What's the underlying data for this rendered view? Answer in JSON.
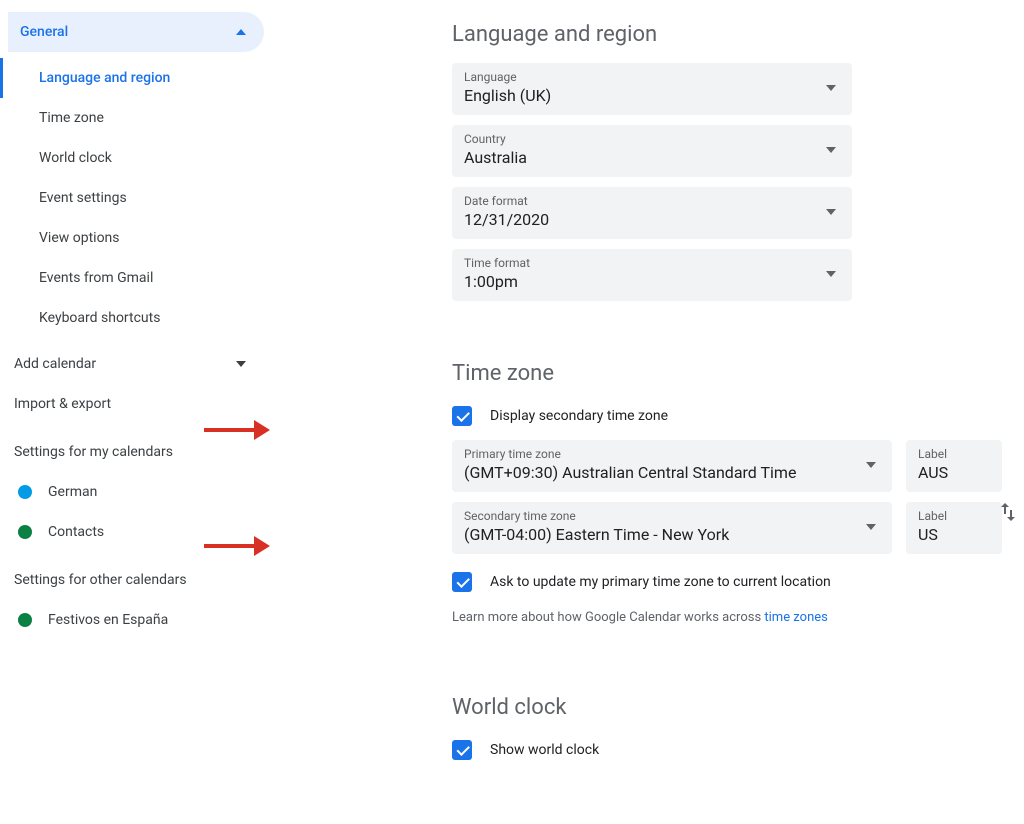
{
  "sidebar": {
    "general": {
      "label": "General",
      "items": [
        "Language and region",
        "Time zone",
        "World clock",
        "Event settings",
        "View options",
        "Events from Gmail",
        "Keyboard shortcuts"
      ]
    },
    "add_calendar": "Add calendar",
    "import_export": "Import & export",
    "my_calendars_label": "Settings for my calendars",
    "my_calendars": [
      {
        "name": "German",
        "color": "#039be5"
      },
      {
        "name": "Contacts",
        "color": "#0b8043"
      }
    ],
    "other_calendars_label": "Settings for other calendars",
    "other_calendars": [
      {
        "name": "Festivos en España",
        "color": "#0b8043"
      }
    ]
  },
  "lang_region": {
    "title": "Language and region",
    "language": {
      "label": "Language",
      "value": "English (UK)"
    },
    "country": {
      "label": "Country",
      "value": "Australia"
    },
    "date_format": {
      "label": "Date format",
      "value": "12/31/2020"
    },
    "time_format": {
      "label": "Time format",
      "value": "1:00pm"
    }
  },
  "time_zone": {
    "title": "Time zone",
    "display_secondary": "Display secondary time zone",
    "primary": {
      "label": "Primary time zone",
      "value": "(GMT+09:30) Australian Central Standard Time"
    },
    "primary_label": {
      "label": "Label",
      "value": "AUS"
    },
    "secondary": {
      "label": "Secondary time zone",
      "value": "(GMT-04:00) Eastern Time - New York"
    },
    "secondary_label": {
      "label": "Label",
      "value": "US"
    },
    "ask_update": "Ask to update my primary time zone to current location",
    "learn_pre": "Learn more about how Google Calendar works across ",
    "learn_link": "time zones"
  },
  "world_clock": {
    "title": "World clock",
    "show": "Show world clock"
  }
}
